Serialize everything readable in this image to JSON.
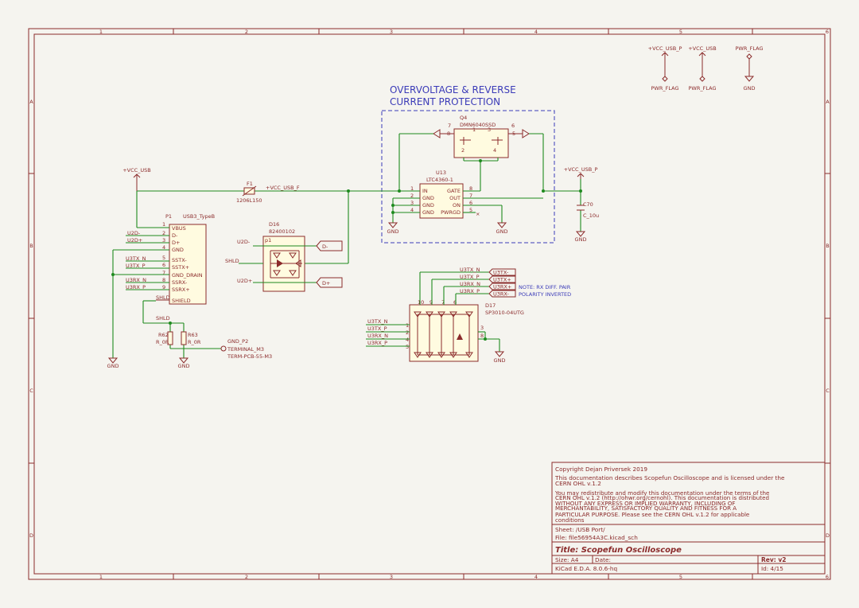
{
  "sheet": {
    "col_labels": [
      "1",
      "2",
      "3",
      "4",
      "5",
      "6"
    ],
    "row_labels": [
      "A",
      "B",
      "C",
      "D"
    ]
  },
  "title_block": {
    "copyright": "Copyright Dejan Priversek 2019",
    "license_line1": "This documentation describes Scopefun Oscilloscope and is licensed under the",
    "license_line2": "CERN OHL v.1.2",
    "notice": [
      "You may redistribute and modify this documentation under the terms of the",
      "CERN OHL v.1.2 (http://ohwr.org/cernohl). This documentation is distributed",
      "WITHOUT ANY EXPRESS OR IMPLIED WARRANTY, INCLUDING OF",
      "MERCHANTABILITY, SATISFACTORY QUALITY AND FITNESS FOR A",
      "PARTICULAR PURPOSE. Please see the CERN OHL v.1.2 for applicable",
      "conditions"
    ],
    "sheet": "Sheet: /USB Port/",
    "file": "File: file56954A3C.kicad_sch",
    "title": "Title: Scopefun Oscilloscope",
    "size": "Size: A4",
    "date": "Date:",
    "rev": "Rev: v2",
    "tool": "KiCad E.D.A. 8.0.6-hq",
    "id": "Id: 4/15"
  },
  "power_flags": [
    {
      "net": "+VCC_USB_P",
      "flag": "PWR_FLAG"
    },
    {
      "net": "+VCC_USB",
      "flag": "PWR_FLAG"
    },
    {
      "net": "PWR_FLAG",
      "flag": "GND"
    }
  ],
  "protection_title": [
    "OVERVOLTAGE & REVERSE",
    "CURRENT PROTECTION"
  ],
  "q4": {
    "ref": "Q4",
    "value": "DMN6040SSD",
    "pins": [
      "7",
      "8",
      "1",
      "2",
      "3",
      "4",
      "6",
      "5"
    ]
  },
  "u13": {
    "ref": "U13",
    "value": "LTC4360-1",
    "left_pins": [
      {
        "num": "1",
        "name": "IN"
      },
      {
        "num": "2",
        "name": "GND"
      },
      {
        "num": "3",
        "name": "GND"
      },
      {
        "num": "4",
        "name": "GND"
      }
    ],
    "right_pins": [
      {
        "num": "8",
        "name": "GATE"
      },
      {
        "num": "7",
        "name": "OUT"
      },
      {
        "num": "6",
        "name": "ON"
      },
      {
        "num": "5",
        "name": "PWRGD"
      }
    ]
  },
  "f1": {
    "ref": "F1",
    "value": "1206L150"
  },
  "nets": {
    "vcc_usb": "+VCC_USB",
    "vcc_usb_f": "+VCC_USB_F",
    "vcc_usb_p": "+VCC_USB_P",
    "gnd": "GND"
  },
  "c70": {
    "ref": "C70",
    "value": "C_10u"
  },
  "p1": {
    "ref": "P1",
    "value": "USB3_TypeB",
    "pins": [
      {
        "num": "1",
        "name": "VBUS",
        "net": ""
      },
      {
        "num": "2",
        "name": "D-",
        "net": "U2D-"
      },
      {
        "num": "3",
        "name": "D+",
        "net": "U2D+"
      },
      {
        "num": "4",
        "name": "GND",
        "net": ""
      },
      {
        "num": "5",
        "name": "SSTX-",
        "net": "U3TX_N"
      },
      {
        "num": "6",
        "name": "SSTX+",
        "net": "U3TX_P"
      },
      {
        "num": "7",
        "name": "GND_DRAIN",
        "net": ""
      },
      {
        "num": "8",
        "name": "SSRX-",
        "net": "U3RX_N"
      },
      {
        "num": "9",
        "name": "SSRX+",
        "net": "U3RX_P"
      }
    ],
    "shield_pin": "SHLD",
    "shield_name": "SHIELD"
  },
  "d16": {
    "ref": "D16",
    "value": "82400102",
    "in_top": "U2D-",
    "in_mid": "SHLD",
    "in_bot": "U2D+"
  },
  "hier_labels": {
    "dm": "D-",
    "dp": "D+"
  },
  "r62": {
    "ref": "R62",
    "value": "R_0R"
  },
  "r63": {
    "ref": "R63",
    "value": "R_0R"
  },
  "terminal": {
    "net": "GND_P2",
    "ref": "TERMINAL_M3",
    "value": "TERM-PCB-55-M3"
  },
  "shld_label": "SHLD",
  "d17": {
    "ref": "D17",
    "value": "SP3010-04UTG",
    "left_nets": [
      "U3TX_N",
      "U3TX_P",
      "U3RX_N",
      "U3RX_P"
    ],
    "left_pins": [
      "1",
      "2",
      "4",
      "5"
    ],
    "top_pins": [
      "10",
      "9",
      "7",
      "6"
    ],
    "right_pins": [
      "3",
      "8"
    ]
  },
  "top_nets": [
    "U3TX_N",
    "U3TX_P",
    "U3RX_N",
    "U3RX_P"
  ],
  "top_labels": [
    "U3TX-",
    "U3TX+",
    "U3RX+",
    "U3RX-"
  ],
  "note": [
    "NOTE: RX DIFF. PAIR",
    "POLARITY INVERTED"
  ]
}
